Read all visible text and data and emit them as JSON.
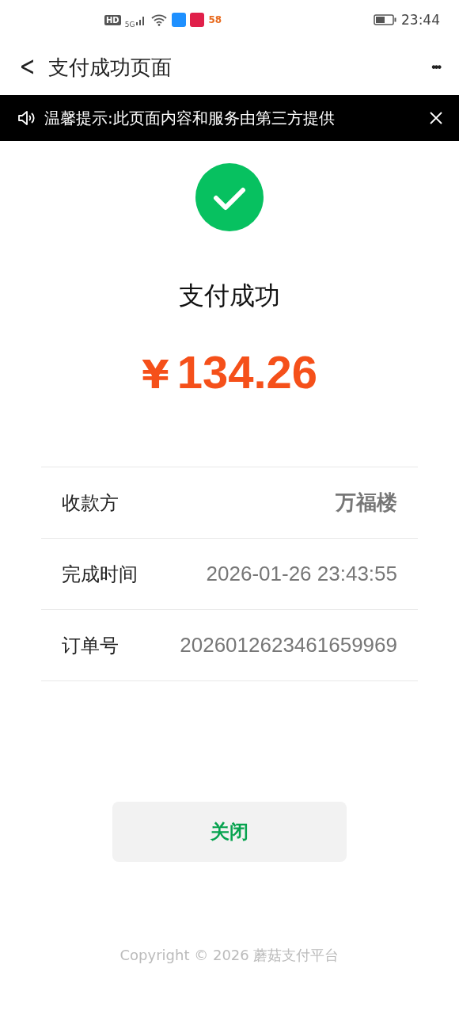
{
  "status_bar": {
    "hd": "HD",
    "network": "5G",
    "app_badge": "58",
    "time": "23:44"
  },
  "nav": {
    "back": "<",
    "title": "支付成功页面",
    "more": "•••"
  },
  "notice": {
    "text": "温馨提示:此页面内容和服务由第三方提供"
  },
  "result": {
    "title": "支付成功",
    "currency": "¥",
    "amount": "134.26"
  },
  "details": [
    {
      "label": "收款方",
      "value": "万福楼",
      "kind": "bold"
    },
    {
      "label": "完成时间",
      "value": "2026-01-26 23:43:55",
      "kind": "plain"
    },
    {
      "label": "订单号",
      "value": "2026012623461659969",
      "kind": "plain"
    }
  ],
  "close_button": "关闭",
  "footer": "Copyright © 2026 蘑菇支付平台"
}
